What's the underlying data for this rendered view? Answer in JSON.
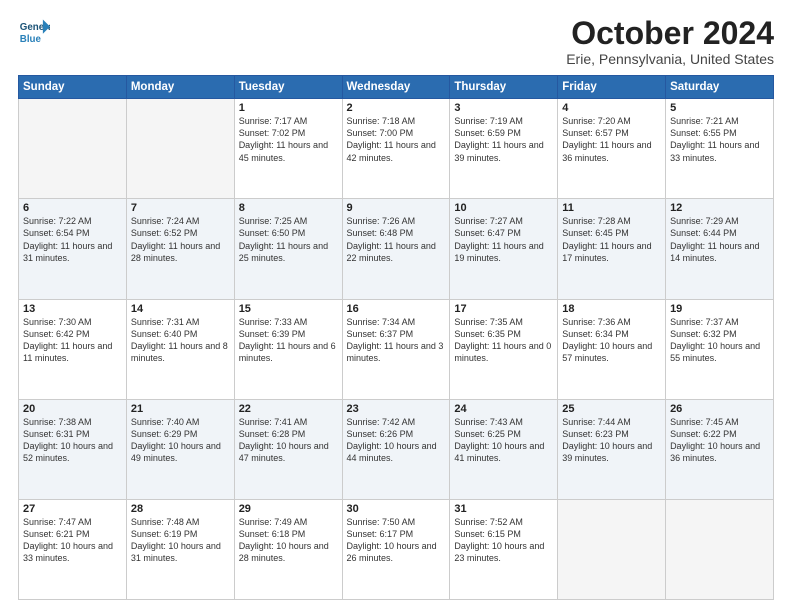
{
  "header": {
    "logo_line1": "General",
    "logo_line2": "Blue",
    "month": "October 2024",
    "location": "Erie, Pennsylvania, United States"
  },
  "weekdays": [
    "Sunday",
    "Monday",
    "Tuesday",
    "Wednesday",
    "Thursday",
    "Friday",
    "Saturday"
  ],
  "weeks": [
    [
      {
        "day": "",
        "info": ""
      },
      {
        "day": "",
        "info": ""
      },
      {
        "day": "1",
        "info": "Sunrise: 7:17 AM\nSunset: 7:02 PM\nDaylight: 11 hours and 45 minutes."
      },
      {
        "day": "2",
        "info": "Sunrise: 7:18 AM\nSunset: 7:00 PM\nDaylight: 11 hours and 42 minutes."
      },
      {
        "day": "3",
        "info": "Sunrise: 7:19 AM\nSunset: 6:59 PM\nDaylight: 11 hours and 39 minutes."
      },
      {
        "day": "4",
        "info": "Sunrise: 7:20 AM\nSunset: 6:57 PM\nDaylight: 11 hours and 36 minutes."
      },
      {
        "day": "5",
        "info": "Sunrise: 7:21 AM\nSunset: 6:55 PM\nDaylight: 11 hours and 33 minutes."
      }
    ],
    [
      {
        "day": "6",
        "info": "Sunrise: 7:22 AM\nSunset: 6:54 PM\nDaylight: 11 hours and 31 minutes."
      },
      {
        "day": "7",
        "info": "Sunrise: 7:24 AM\nSunset: 6:52 PM\nDaylight: 11 hours and 28 minutes."
      },
      {
        "day": "8",
        "info": "Sunrise: 7:25 AM\nSunset: 6:50 PM\nDaylight: 11 hours and 25 minutes."
      },
      {
        "day": "9",
        "info": "Sunrise: 7:26 AM\nSunset: 6:48 PM\nDaylight: 11 hours and 22 minutes."
      },
      {
        "day": "10",
        "info": "Sunrise: 7:27 AM\nSunset: 6:47 PM\nDaylight: 11 hours and 19 minutes."
      },
      {
        "day": "11",
        "info": "Sunrise: 7:28 AM\nSunset: 6:45 PM\nDaylight: 11 hours and 17 minutes."
      },
      {
        "day": "12",
        "info": "Sunrise: 7:29 AM\nSunset: 6:44 PM\nDaylight: 11 hours and 14 minutes."
      }
    ],
    [
      {
        "day": "13",
        "info": "Sunrise: 7:30 AM\nSunset: 6:42 PM\nDaylight: 11 hours and 11 minutes."
      },
      {
        "day": "14",
        "info": "Sunrise: 7:31 AM\nSunset: 6:40 PM\nDaylight: 11 hours and 8 minutes."
      },
      {
        "day": "15",
        "info": "Sunrise: 7:33 AM\nSunset: 6:39 PM\nDaylight: 11 hours and 6 minutes."
      },
      {
        "day": "16",
        "info": "Sunrise: 7:34 AM\nSunset: 6:37 PM\nDaylight: 11 hours and 3 minutes."
      },
      {
        "day": "17",
        "info": "Sunrise: 7:35 AM\nSunset: 6:35 PM\nDaylight: 11 hours and 0 minutes."
      },
      {
        "day": "18",
        "info": "Sunrise: 7:36 AM\nSunset: 6:34 PM\nDaylight: 10 hours and 57 minutes."
      },
      {
        "day": "19",
        "info": "Sunrise: 7:37 AM\nSunset: 6:32 PM\nDaylight: 10 hours and 55 minutes."
      }
    ],
    [
      {
        "day": "20",
        "info": "Sunrise: 7:38 AM\nSunset: 6:31 PM\nDaylight: 10 hours and 52 minutes."
      },
      {
        "day": "21",
        "info": "Sunrise: 7:40 AM\nSunset: 6:29 PM\nDaylight: 10 hours and 49 minutes."
      },
      {
        "day": "22",
        "info": "Sunrise: 7:41 AM\nSunset: 6:28 PM\nDaylight: 10 hours and 47 minutes."
      },
      {
        "day": "23",
        "info": "Sunrise: 7:42 AM\nSunset: 6:26 PM\nDaylight: 10 hours and 44 minutes."
      },
      {
        "day": "24",
        "info": "Sunrise: 7:43 AM\nSunset: 6:25 PM\nDaylight: 10 hours and 41 minutes."
      },
      {
        "day": "25",
        "info": "Sunrise: 7:44 AM\nSunset: 6:23 PM\nDaylight: 10 hours and 39 minutes."
      },
      {
        "day": "26",
        "info": "Sunrise: 7:45 AM\nSunset: 6:22 PM\nDaylight: 10 hours and 36 minutes."
      }
    ],
    [
      {
        "day": "27",
        "info": "Sunrise: 7:47 AM\nSunset: 6:21 PM\nDaylight: 10 hours and 33 minutes."
      },
      {
        "day": "28",
        "info": "Sunrise: 7:48 AM\nSunset: 6:19 PM\nDaylight: 10 hours and 31 minutes."
      },
      {
        "day": "29",
        "info": "Sunrise: 7:49 AM\nSunset: 6:18 PM\nDaylight: 10 hours and 28 minutes."
      },
      {
        "day": "30",
        "info": "Sunrise: 7:50 AM\nSunset: 6:17 PM\nDaylight: 10 hours and 26 minutes."
      },
      {
        "day": "31",
        "info": "Sunrise: 7:52 AM\nSunset: 6:15 PM\nDaylight: 10 hours and 23 minutes."
      },
      {
        "day": "",
        "info": ""
      },
      {
        "day": "",
        "info": ""
      }
    ]
  ]
}
